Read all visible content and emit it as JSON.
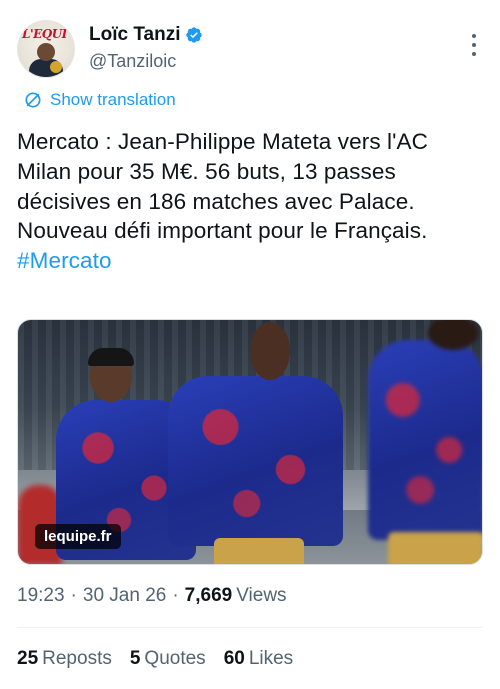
{
  "author": {
    "name": "Loïc Tanzi",
    "handle": "@Tanziloic",
    "verified": true,
    "avatar_brand": "L'EQUI"
  },
  "translate_label": "Show translation",
  "tweet": {
    "text": "Mercato : Jean-Philippe Mateta vers l'AC Milan pour 35 M€. 56 buts, 13 passes décisives en 186 matches avec Palace. Nouveau défi important pour le Français. ",
    "hashtag": "#Mercato"
  },
  "media": {
    "source_badge": "lequipe.fr"
  },
  "meta": {
    "time": "19:23",
    "date": "30 Jan 26",
    "separator": "·",
    "views_count": "7,669",
    "views_label": "Views"
  },
  "stats": {
    "reposts_count": "25",
    "reposts_label": "Reposts",
    "quotes_count": "5",
    "quotes_label": "Quotes",
    "likes_count": "60",
    "likes_label": "Likes"
  },
  "colors": {
    "accent": "#1d9bf0",
    "text": "#0f1419",
    "muted": "#536471"
  },
  "icons": [
    "verified-badge-icon",
    "more-options-icon",
    "translate-icon"
  ]
}
